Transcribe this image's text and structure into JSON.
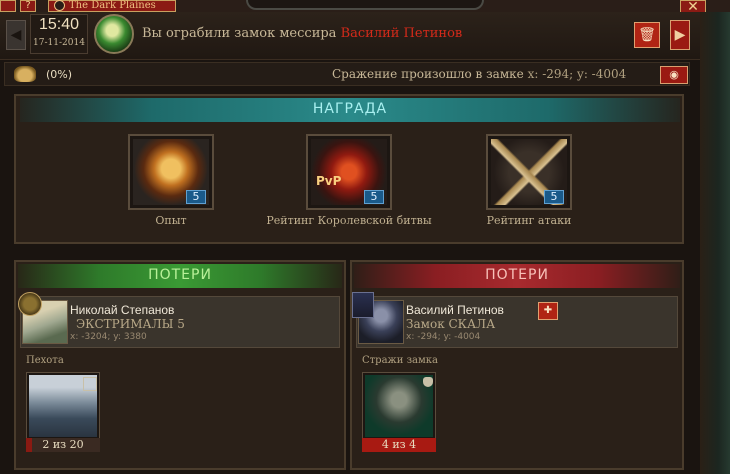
{
  "topbar": {
    "realm_tab": "The Dark Plaines",
    "help_label": "?",
    "close_label": "✕"
  },
  "header": {
    "time": "15:40",
    "date": "17-11-2014",
    "prev_arrow": "◀",
    "next_arrow": "▶",
    "message_prefix": "Вы ограбили замок мессира",
    "message_name": "Василий Петинов",
    "delete_icon": "trash-icon"
  },
  "info": {
    "percent": "(0%)",
    "battle_text": "Сражение произошло в замке",
    "coords": "x: -294; y: -4004",
    "eye_icon": "eye-icon"
  },
  "reward": {
    "title": "НАГРАДА",
    "items": [
      {
        "label": "Опыт",
        "value": "5",
        "icon": "shield-icon"
      },
      {
        "label": "Рейтинг Королевской битвы",
        "value": "5",
        "icon": "pvp-icon",
        "badge_text": "PvP"
      },
      {
        "label": "Рейтинг атаки",
        "value": "5",
        "icon": "crossed-swords-icon"
      }
    ]
  },
  "attacker": {
    "title": "ПОТЕРИ",
    "name": "Николай Степанов",
    "clan": "ЭКСТРИМАЛЫ 5",
    "coords": "x: -3204; y: 3380",
    "section": "Пехота",
    "unit_count": "2 из 20",
    "band_color": "#2e7a2a",
    "title_color": "#b8f098"
  },
  "defender": {
    "title": "ПОТЕРИ",
    "name": "Василий Петинов",
    "clan": "Замок СКАЛА",
    "coords": "x: -294; y: -4004",
    "section": "Стражи замка",
    "unit_count": "4 из 4",
    "band_color": "#8a1e22",
    "title_color": "#f8c0b8"
  }
}
